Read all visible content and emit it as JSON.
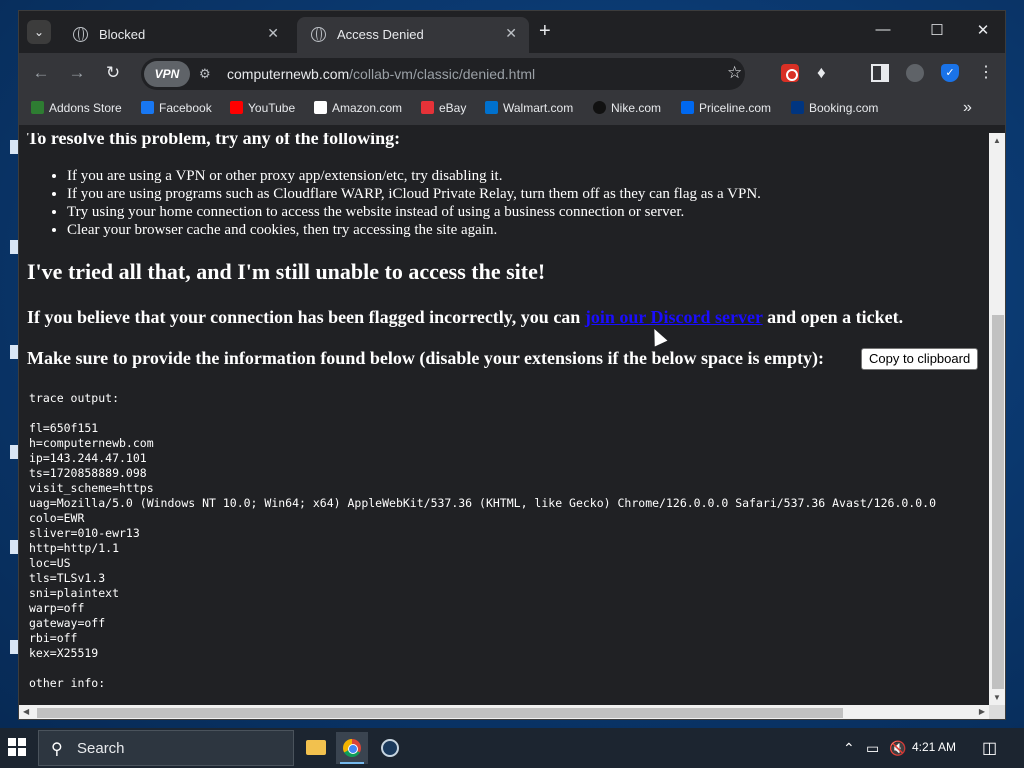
{
  "browser": {
    "tabs": [
      {
        "label": "Blocked",
        "active": false
      },
      {
        "label": "Access Denied",
        "active": true
      }
    ],
    "new_tab": "+",
    "address": {
      "vpn_badge": "VPN",
      "domain": "computernewb.com",
      "path": "/collab-vm/classic/denied.html"
    },
    "bookmarks": [
      {
        "label": "Addons Store",
        "icon": "addons-store-icon",
        "color": "#2e7d32"
      },
      {
        "label": "Facebook",
        "icon": "facebook-icon",
        "color": "#1877f2"
      },
      {
        "label": "YouTube",
        "icon": "youtube-icon",
        "color": "#ff0000"
      },
      {
        "label": "Amazon.com",
        "icon": "amazon-icon",
        "color": "#ffffff"
      },
      {
        "label": "eBay",
        "icon": "ebay-icon",
        "color": "#e53238"
      },
      {
        "label": "Walmart.com",
        "icon": "walmart-icon",
        "color": "#0071ce"
      },
      {
        "label": "Nike.com",
        "icon": "nike-icon",
        "color": "#111111"
      },
      {
        "label": "Priceline.com",
        "icon": "priceline-icon",
        "color": "#0068ef"
      },
      {
        "label": "Booking.com",
        "icon": "booking-icon",
        "color": "#003580"
      }
    ]
  },
  "page": {
    "top_heading": "To resolve this problem, try any of the following:",
    "tips": [
      "If you are using a VPN or other proxy app/extension/etc, try disabling it.",
      "If you are using programs such as Cloudflare WARP, iCloud Private Relay, turn them off as they can flag as a VPN.",
      "Try using your home connection to access the website instead of using a business connection or server.",
      "Clear your browser cache and cookies, then try accessing the site again."
    ],
    "still_heading": "I've tried all that, and I'm still unable to access the site!",
    "flagged_before": "If you believe that your connection has been flagged incorrectly, you can ",
    "flagged_link": "join our Discord server",
    "flagged_after": " and open a ticket.",
    "provide_text": "Make sure to provide the information found below (disable your extensions if the below space is empty):",
    "copy_button": "Copy to clipboard",
    "trace": "trace output:\n\nfl=650f151\nh=computernewb.com\nip=143.244.47.101\nts=1720858889.098\nvisit_scheme=https\nuag=Mozilla/5.0 (Windows NT 10.0; Win64; x64) AppleWebKit/537.36 (KHTML, like Gecko) Chrome/126.0.0.0 Safari/537.36 Avast/126.0.0.0\ncolo=EWR\nsliver=010-ewr13\nhttp=http/1.1\nloc=US\ntls=TLSv1.3\nsni=plaintext\nwarp=off\ngateway=off\nrbi=off\nkex=X25519\n\nother info:"
  },
  "taskbar": {
    "search_label": "Search",
    "time": "4:21 AM"
  },
  "colors": {
    "page_bg": "#202124",
    "link": "#1a0dff",
    "taskbar": "#1c2530"
  }
}
